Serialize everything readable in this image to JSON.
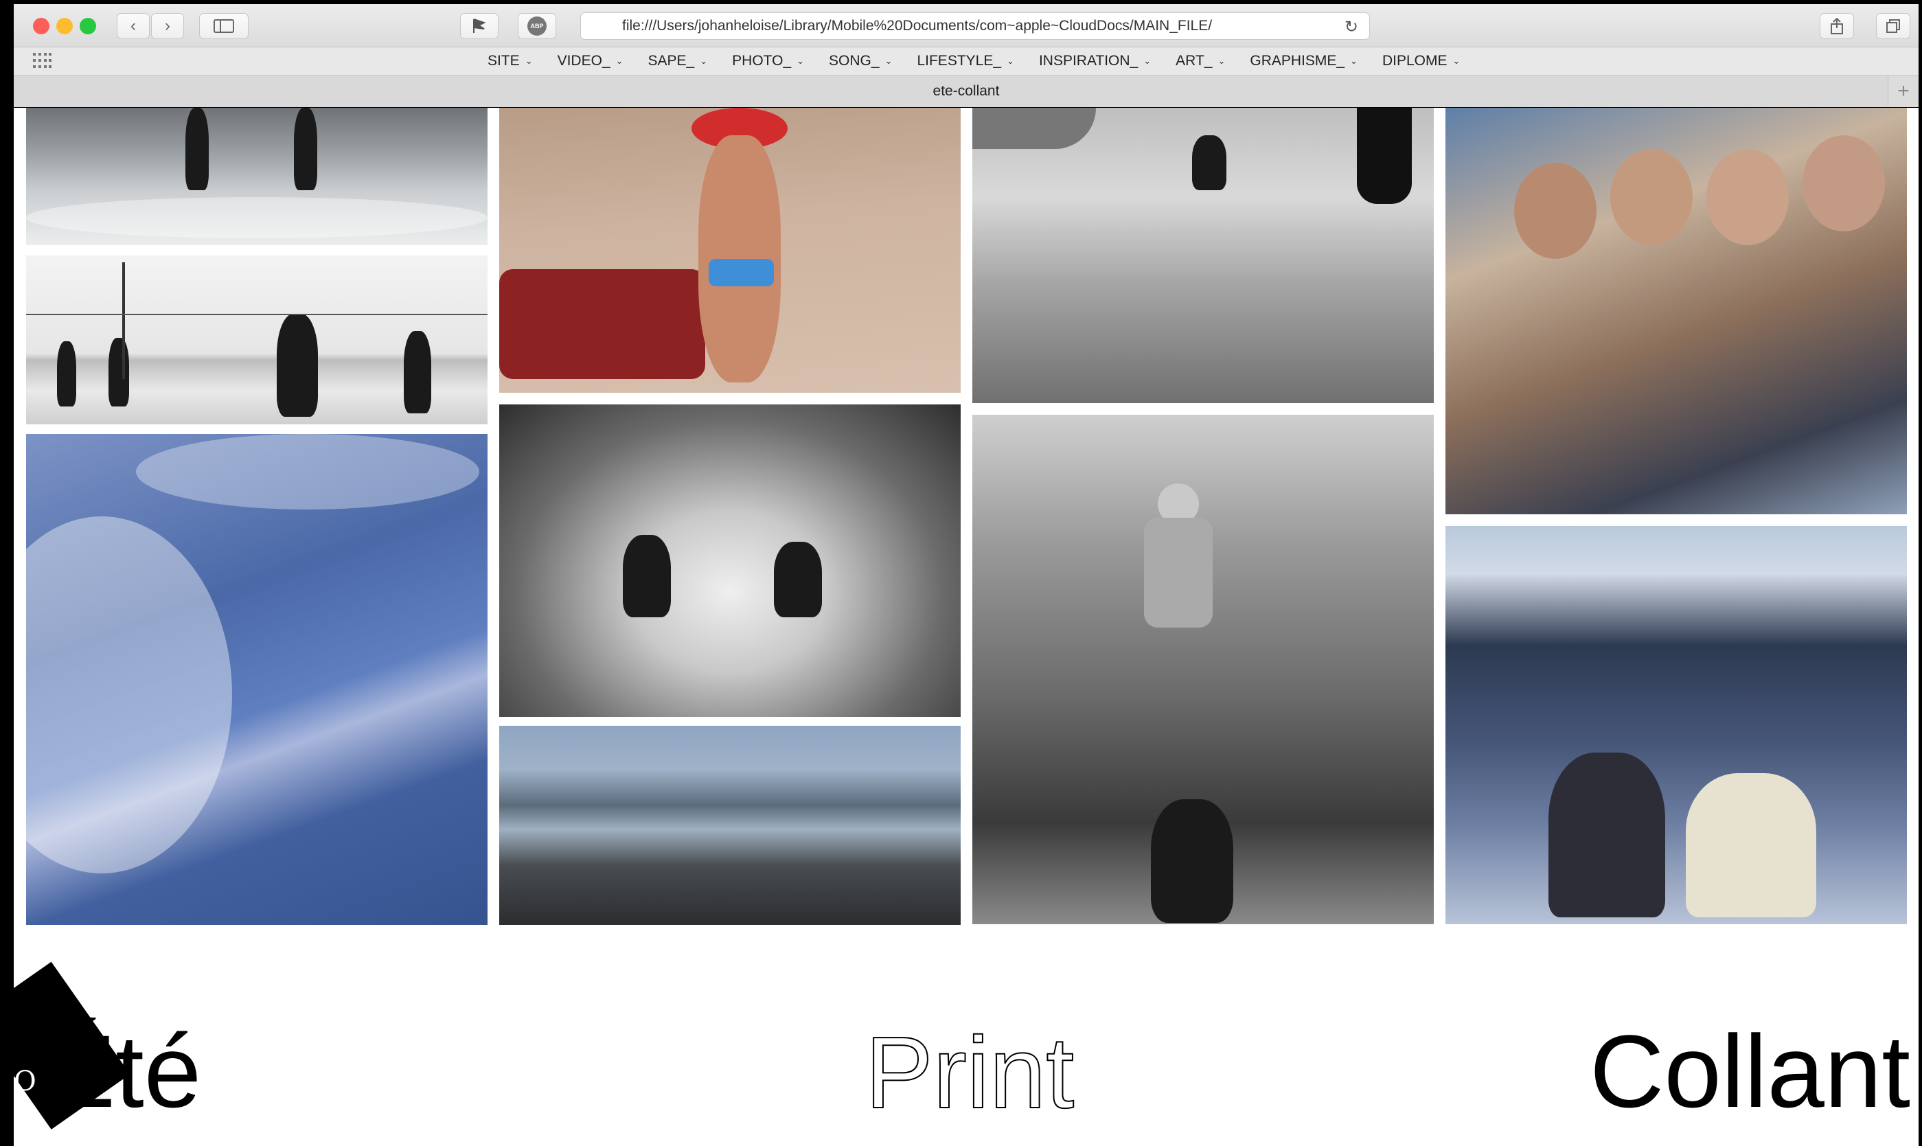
{
  "window": {
    "traffic_lights": {
      "close": "#fc5f57",
      "minimize": "#fdbc2e",
      "zoom": "#28c840"
    },
    "address_url": "file:///Users/johanheloise/Library/Mobile%20Documents/com~apple~CloudDocs/MAIN_FILE/",
    "adblock_label": "ABP",
    "tab_title": "ete-collant",
    "new_tab": "+"
  },
  "bookmarks": [
    {
      "label": "SITE"
    },
    {
      "label": "VIDEO_"
    },
    {
      "label": "SAPE_"
    },
    {
      "label": "PHOTO_"
    },
    {
      "label": "SONG_"
    },
    {
      "label": "LIFESTYLE_"
    },
    {
      "label": "INSPIRATION_"
    },
    {
      "label": "ART_"
    },
    {
      "label": "GRAPHISME_"
    },
    {
      "label": "DIPLOME"
    }
  ],
  "page": {
    "title_left": "Été",
    "title_center": "Print",
    "title_right": "Collant",
    "corner_mark": "O"
  }
}
